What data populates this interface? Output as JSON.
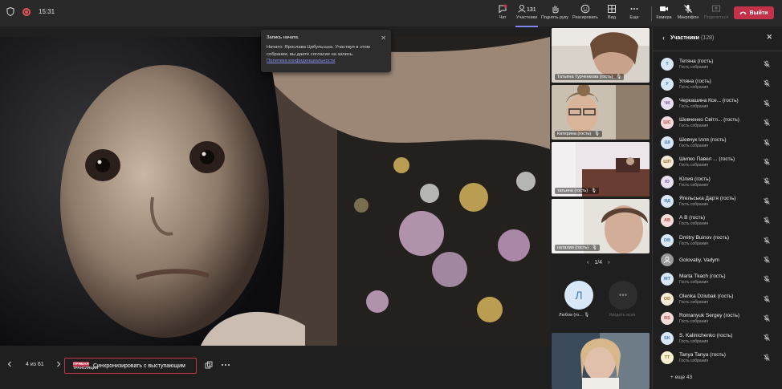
{
  "header": {
    "time": "15:31",
    "buttons": [
      {
        "id": "chat",
        "label": "Чат",
        "icon": "chat-icon"
      },
      {
        "id": "participants",
        "label": "Участники",
        "count": "131",
        "icon": "people-icon"
      },
      {
        "id": "raise_hand",
        "label": "Поднять руку",
        "icon": "hand-icon"
      },
      {
        "id": "react",
        "label": "Реагировать",
        "icon": "smiley-icon"
      },
      {
        "id": "view",
        "label": "Вид",
        "icon": "grid-icon"
      },
      {
        "id": "more",
        "label": "Еще",
        "icon": "more-icon"
      },
      {
        "id": "camera",
        "label": "Камера",
        "icon": "camera-icon"
      },
      {
        "id": "mic",
        "label": "Микрофон",
        "icon": "mic-off-icon"
      },
      {
        "id": "share",
        "label": "Поделиться",
        "icon": "share-icon"
      }
    ],
    "leave_label": "Выйти"
  },
  "toast": {
    "title": "Запись начата.",
    "body": "Начато: Ярослава Цибульська. Участвуя в этом собрании, вы даете согласие на запись.",
    "link": "Политика конфиденциальности"
  },
  "bottom": {
    "slide_counter": "4 из 61",
    "live_top": "ПРЯМАЯ",
    "live_bottom": "ТРАНСЛЯЦИЯ",
    "sync_label": "Синхронизировать с выступающим"
  },
  "tiles": [
    {
      "name": "Татьяна Турченкова (гость)"
    },
    {
      "name": "Катерина (гость)"
    },
    {
      "name": "татьяна (гость)"
    },
    {
      "name": "наталия (гость)"
    }
  ],
  "tile_page": "1/4",
  "avatars": {
    "user_initial": "Л",
    "user_label": "Любов (го...",
    "view_all_label": "Увидеть всех"
  },
  "panel": {
    "title": "Участники",
    "count": "(128)",
    "participants": [
      {
        "initials": "Т",
        "name": "Тетяна (гость)",
        "sub": "Гость собрания",
        "color": "#d8e8f8",
        "fg": "#4a7ab0"
      },
      {
        "initials": "У",
        "name": "Уляна (гость)",
        "sub": "Гость собрания",
        "color": "#d8e8f8",
        "fg": "#4a7ab0"
      },
      {
        "initials": "ЧК",
        "name": "Черкашина Ксе...  (гость)",
        "sub": "Гость собрания",
        "color": "#e8e0f0",
        "fg": "#7a5a9a"
      },
      {
        "initials": "ШС",
        "name": "Шевченко Світл...  (гость)",
        "sub": "Гость собрания",
        "color": "#f8dcdc",
        "fg": "#b04a4a"
      },
      {
        "initials": "ШІ",
        "name": "Шевчук Ілля (гость)",
        "sub": "Гость собрания",
        "color": "#d8e8f8",
        "fg": "#4a7ab0"
      },
      {
        "initials": "ШП",
        "name": "Шипко Павел ...  (гость)",
        "sub": "Гость собрания",
        "color": "#f8ecd8",
        "fg": "#a0702a"
      },
      {
        "initials": "Ю",
        "name": "Юлия (гость)",
        "sub": "Гость собрания",
        "color": "#e8e0f0",
        "fg": "#7a5a9a"
      },
      {
        "initials": "ЯД",
        "name": "Ягельська Дар'я (гость)",
        "sub": "Гость собрания",
        "color": "#d8e8f8",
        "fg": "#4a7ab0"
      },
      {
        "initials": "АВ",
        "name": "А В (гость)",
        "sub": "Гость собрания",
        "color": "#f8dcdc",
        "fg": "#b04a4a"
      },
      {
        "initials": "DB",
        "name": "Dmitry Buinov (гость)",
        "sub": "Гость собрания",
        "color": "#d8e8f8",
        "fg": "#4a7ab0"
      },
      {
        "initials": "",
        "name": "Golovatiy, Vadym",
        "sub": "",
        "color": "#9a9a9a",
        "fg": "#ffffff"
      },
      {
        "initials": "MT",
        "name": "Marta Tkach (гость)",
        "sub": "Гость собрания",
        "color": "#d8e8f8",
        "fg": "#4a7ab0"
      },
      {
        "initials": "OD",
        "name": "Olenka Dziubak (гость)",
        "sub": "Гость собрания",
        "color": "#f8ecd8",
        "fg": "#a0702a"
      },
      {
        "initials": "RS",
        "name": "Romanyuk Sergey (гость)",
        "sub": "Гость собрания",
        "color": "#f8dcdc",
        "fg": "#b04a4a"
      },
      {
        "initials": "SK",
        "name": "S. Kalinichenko (гость)",
        "sub": "Гость собрания",
        "color": "#d8e8f8",
        "fg": "#4a7ab0"
      },
      {
        "initials": "TT",
        "name": "Tanya Tanya (гость)",
        "sub": "Гость собрания",
        "color": "#f8f0d0",
        "fg": "#8a7a2a"
      }
    ],
    "more_label": "+ еще 43"
  }
}
